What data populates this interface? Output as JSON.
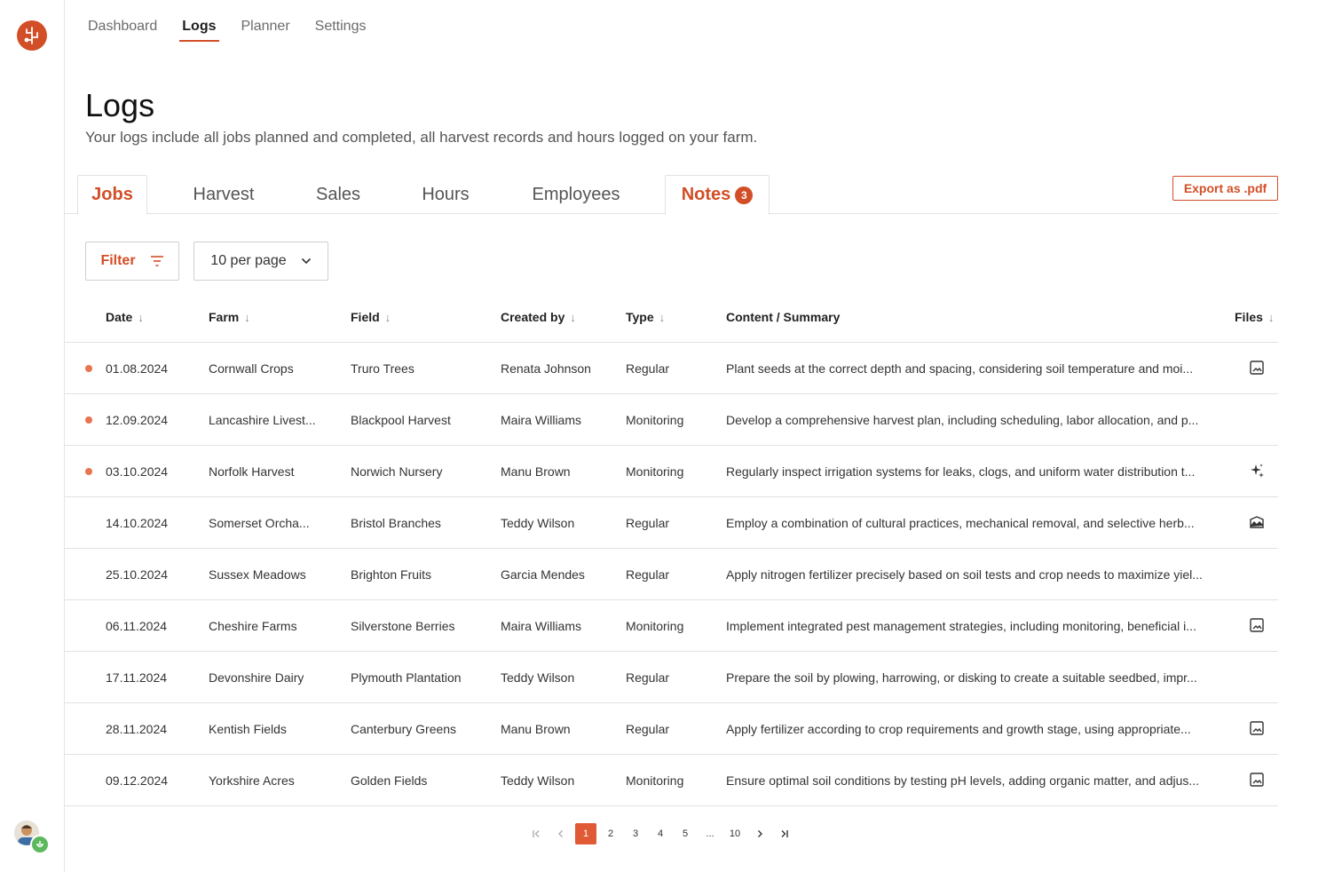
{
  "app": {
    "nav": [
      "Dashboard",
      "Logs",
      "Planner",
      "Settings"
    ],
    "active_nav": "Logs"
  },
  "page": {
    "title": "Logs",
    "subtitle": "Your logs include all jobs planned and completed, all harvest records and hours logged on your farm."
  },
  "tabs": [
    {
      "label": "Jobs",
      "active": true
    },
    {
      "label": "Harvest",
      "active": false
    },
    {
      "label": "Sales",
      "active": false
    },
    {
      "label": "Hours",
      "active": false
    },
    {
      "label": "Employees",
      "active": false
    },
    {
      "label": "Notes",
      "active": true,
      "count": "3"
    }
  ],
  "toolbar": {
    "export_label": "Export as .pdf",
    "filter_label": "Filter",
    "per_page_label": "10 per page"
  },
  "table": {
    "columns": [
      "Date",
      "Farm",
      "Field",
      "Created by",
      "Type",
      "Content / Summary",
      "Files"
    ],
    "rows": [
      {
        "flag": true,
        "date": "01.08.2024",
        "farm": "Cornwall Crops",
        "field": "Truro Trees",
        "created_by": "Renata Johnson",
        "type": "Regular",
        "content": "Plant seeds at the correct depth and spacing, considering soil temperature and moi...",
        "file": "image-icon"
      },
      {
        "flag": true,
        "date": "12.09.2024",
        "farm": "Lancashire Livest...",
        "field": "Blackpool Harvest",
        "created_by": "Maira Williams",
        "type": "Monitoring",
        "content": "Develop a comprehensive harvest plan, including scheduling, labor allocation, and p...",
        "file": ""
      },
      {
        "flag": true,
        "date": "03.10.2024",
        "farm": "Norfolk Harvest",
        "field": "Norwich Nursery",
        "created_by": "Manu Brown",
        "type": "Monitoring",
        "content": "Regularly inspect irrigation systems for leaks, clogs, and uniform water distribution t...",
        "file": "sparkle-icon"
      },
      {
        "flag": false,
        "date": "14.10.2024",
        "farm": "Somerset Orcha...",
        "field": "Bristol Branches",
        "created_by": "Teddy Wilson",
        "type": "Regular",
        "content": "Employ a combination of cultural practices, mechanical removal, and selective herb...",
        "file": "landscape-icon"
      },
      {
        "flag": false,
        "date": "25.10.2024",
        "farm": "Sussex Meadows",
        "field": "Brighton Fruits",
        "created_by": "Garcia Mendes",
        "type": "Regular",
        "content": "Apply nitrogen fertilizer precisely based on soil tests and crop needs to maximize yiel...",
        "file": ""
      },
      {
        "flag": false,
        "date": "06.11.2024",
        "farm": "Cheshire Farms",
        "field": "Silverstone Berries",
        "created_by": "Maira Williams",
        "type": "Monitoring",
        "content": "Implement integrated pest management strategies, including monitoring, beneficial i...",
        "file": "image-icon"
      },
      {
        "flag": false,
        "date": "17.11.2024",
        "farm": "Devonshire Dairy",
        "field": "Plymouth Plantation",
        "created_by": "Teddy Wilson",
        "type": "Regular",
        "content": "Prepare the soil by plowing, harrowing, or disking to create a suitable seedbed, impr...",
        "file": ""
      },
      {
        "flag": false,
        "date": "28.11.2024",
        "farm": "Kentish Fields",
        "field": "Canterbury Greens",
        "created_by": "Manu Brown",
        "type": "Regular",
        "content": "Apply fertilizer according to crop requirements and growth stage, using appropriate...",
        "file": "image-icon"
      },
      {
        "flag": false,
        "date": "09.12.2024",
        "farm": "Yorkshire Acres",
        "field": "Golden Fields",
        "created_by": "Teddy Wilson",
        "type": "Monitoring",
        "content": "Ensure optimal soil conditions by testing pH levels, adding organic matter, and adjus...",
        "file": "image-icon"
      }
    ]
  },
  "pagination": {
    "pages": [
      "1",
      "2",
      "3",
      "4",
      "5",
      "...",
      "10"
    ],
    "current": "1"
  },
  "colors": {
    "accent": "#d24e26",
    "flag": "#e8734f",
    "badge_green": "#5cb85c"
  }
}
